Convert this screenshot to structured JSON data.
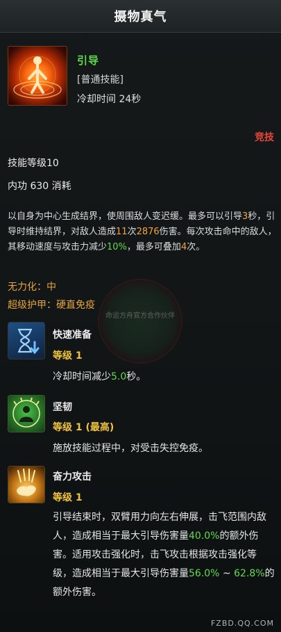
{
  "header": {
    "title": "摄物真气"
  },
  "skill": {
    "name": "引导",
    "type": "[普通技能]",
    "cooldown": "冷却时间 24秒",
    "tag": "竞技",
    "level": "技能等级10",
    "cost": "内功 630 消耗",
    "description": {
      "p1": "以自身为中心生成结界，使周围敌人变迟缓。最多可以引导",
      "v1": "3",
      "p2": "秒，引导时维持结界，对敌人造成",
      "v2": "11",
      "p3": "次",
      "v3": "2876",
      "p4": "伤害。每次攻击命中的敌人，其移动速度与攻击力减少",
      "v4": "10%",
      "p5": "，最多可叠加",
      "v5": "4",
      "p6": "次。"
    },
    "attributes": [
      {
        "label": "无力化：",
        "value": "中"
      },
      {
        "label": "超级护甲：",
        "value": "硬直免疫"
      }
    ],
    "icon": "channeling-figure-icon"
  },
  "watermark_text": "命运方舟官方合作伙伴",
  "sub_skills": [
    {
      "name": "快速准备",
      "level": "等级 1",
      "icon": "hourglass-icon",
      "desc": {
        "p1": "冷却时间减少",
        "v1": "5.0",
        "p2": "秒。"
      }
    },
    {
      "name": "坚韧",
      "level": "等级 1 (最高)",
      "icon": "resilience-figure-icon",
      "desc": {
        "text": "施放技能过程中，对受击失控免疫。"
      }
    },
    {
      "name": "奋力攻击",
      "level": "等级 1",
      "icon": "power-hand-icon",
      "desc": {
        "p1": "引导结束时，双臂用力向左右伸展，击飞范围内敌人，造成相当于最大引导伤害量",
        "v1": "40.0%",
        "p2": "的额外伤害。适用攻击强化时，击飞攻击根据攻击强化等级，造成相当于最大引导伤害量",
        "v2": "56.0%",
        "p3": " ~ ",
        "v3": "62.8%",
        "p4": "的额外伤害。"
      }
    }
  ],
  "footer": {
    "site": "FZBD.QQ.COM"
  }
}
